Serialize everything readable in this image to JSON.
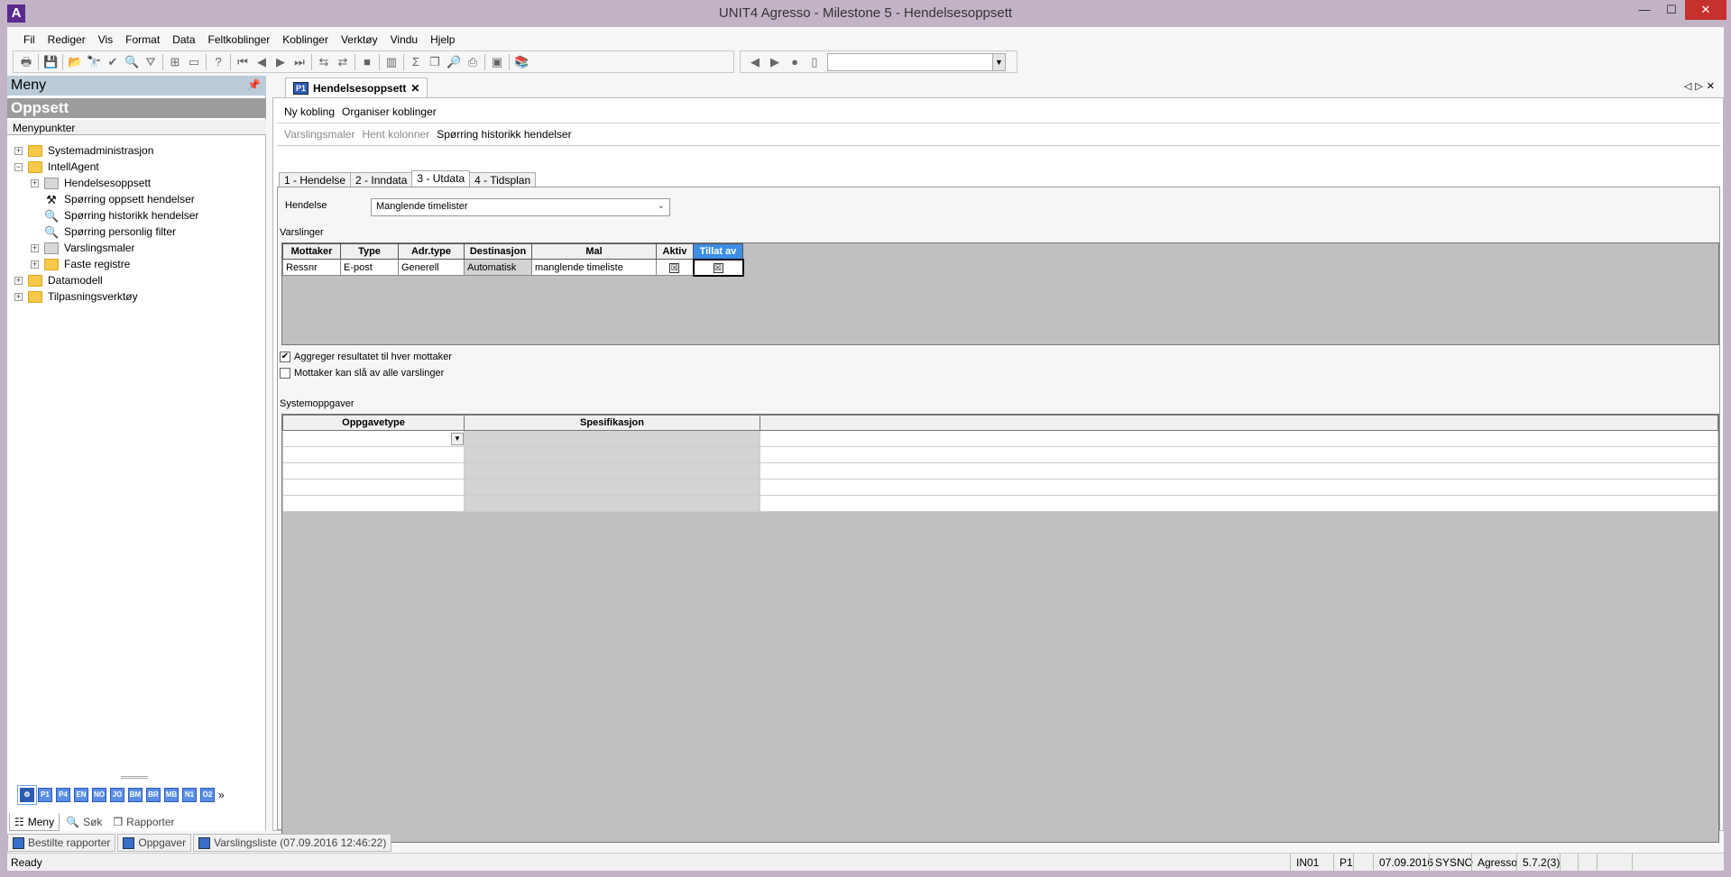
{
  "window": {
    "title": "UNIT4 Agresso - Milestone 5 - Hendelsesoppsett",
    "logo": "A",
    "controls": [
      "minimize",
      "maximize",
      "close"
    ]
  },
  "menubar": [
    "Fil",
    "Rediger",
    "Vis",
    "Format",
    "Data",
    "Feltkoblinger",
    "Koblinger",
    "Verktøy",
    "Vindu",
    "Hjelp"
  ],
  "toolbar": {
    "icons": [
      "print-icon",
      "save-icon",
      "open-icon",
      "find-icon",
      "check-icon",
      "search-icon",
      "filter-icon",
      "insert-row-icon",
      "blank-icon",
      "help-icon",
      "first-icon",
      "prev-icon",
      "next-icon",
      "last-icon",
      "link-icon",
      "unlink-icon",
      "stop-icon",
      "chart-icon",
      "sum-icon",
      "copy-icon",
      "zoom-icon",
      "print-preview-icon",
      "window-icon",
      "books-icon"
    ],
    "nav_icons": [
      "back-icon",
      "forward-icon",
      "stop-circle-icon",
      "page-icon"
    ],
    "combo_value": ""
  },
  "left": {
    "header": "Meny",
    "section": "Oppsett",
    "subheader": "Menypunkter",
    "tree": [
      {
        "label": "Systemadministrasjon",
        "level": 0,
        "exp": "+",
        "icon": "folder"
      },
      {
        "label": "IntellAgent",
        "level": 0,
        "exp": "-",
        "icon": "folder"
      },
      {
        "label": "Hendelsesoppsett",
        "level": 1,
        "exp": "+",
        "icon": "form"
      },
      {
        "label": "Spørring oppsett hendelser",
        "level": 1,
        "exp": "",
        "icon": "tools"
      },
      {
        "label": "Spørring historikk hendelser",
        "level": 1,
        "exp": "",
        "icon": "mag"
      },
      {
        "label": "Spørring personlig filter",
        "level": 1,
        "exp": "",
        "icon": "mag"
      },
      {
        "label": "Varslingsmaler",
        "level": 1,
        "exp": "+",
        "icon": "form"
      },
      {
        "label": "Faste registre",
        "level": 1,
        "exp": "+",
        "icon": "folder"
      },
      {
        "label": "Datamodell",
        "level": 0,
        "exp": "+",
        "icon": "folder"
      },
      {
        "label": "Tilpasningsverktøy",
        "level": 0,
        "exp": "+",
        "icon": "folder"
      }
    ],
    "shortcuts": [
      "⚙",
      "P1",
      "P4",
      "EN",
      "NO",
      "JO",
      "BM",
      "BR",
      "MB",
      "N1",
      "O2"
    ],
    "more": "»",
    "tabs": [
      "Meny",
      "Søk",
      "Rapporter"
    ]
  },
  "doc": {
    "tab_badge": "P1",
    "tab_label": "Hendelsesoppsett",
    "actions1": [
      "Ny kobling",
      "Organiser koblinger"
    ],
    "actions2": [
      {
        "label": "Varslingsmaler",
        "disabled": true
      },
      {
        "label": "Hent kolonner",
        "disabled": true
      },
      {
        "label": "Spørring historikk hendelser",
        "disabled": false
      }
    ],
    "tabs": [
      "1 - Hendelse",
      "2 - Inndata",
      "3 - Utdata",
      "4 - Tidsplan"
    ],
    "active_tab": 2,
    "hendelse_label": "Hendelse",
    "hendelse_value": "Manglende timelister",
    "varslinger_label": "Varslinger",
    "varslinger_columns": [
      "Mottaker",
      "Type",
      "Adr.type",
      "Destinasjon",
      "Mal",
      "Aktiv",
      "Tillat av"
    ],
    "varslinger_rows": [
      [
        "Ressnr",
        "E-post",
        "Generell",
        "Automatisk",
        "manglende timeliste",
        "☒",
        "☒"
      ]
    ],
    "check1": {
      "label": "Aggreger resultatet til hver mottaker",
      "checked": true
    },
    "check2": {
      "label": "Mottaker kan slå av alle varslinger",
      "checked": false
    },
    "system_label": "Systemoppgaver",
    "system_columns": [
      "Oppgavetype",
      "Spesifikasjon",
      ""
    ]
  },
  "bottom_tabs": [
    "Bestilte rapporter",
    "Oppgaver",
    "Varslingsliste (07.09.2016 12:46:22)"
  ],
  "status": {
    "text": "Ready",
    "cells": [
      "IN01",
      "P1",
      "",
      "07.09.2016",
      "SYSNO",
      "Agresso",
      "5.7.2(3)",
      "",
      "",
      "",
      ""
    ]
  }
}
